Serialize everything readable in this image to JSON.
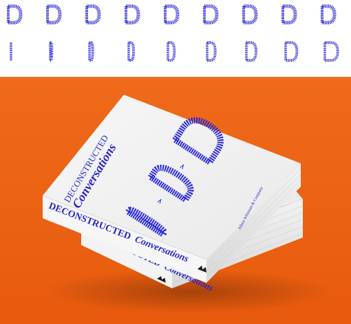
{
  "cover": {
    "title_line1": "DECONSTRUCTED",
    "title_line2": "Conversations",
    "publisher": "Albert Whitman & Company"
  },
  "spine": {
    "title_word1": "DECONSTRUCTED",
    "title_word2": "Conversations"
  },
  "logo_icon": "publisher-logo-icon",
  "colors": {
    "background_top": "#ffffff",
    "background_bottom": "#ec6010",
    "ink_blue": "#2a2ad8",
    "book_white": "#f4f4f4",
    "logo_dark": "#1b1b1b"
  },
  "strip": {
    "row1_count": 9,
    "row2_count": 9
  }
}
